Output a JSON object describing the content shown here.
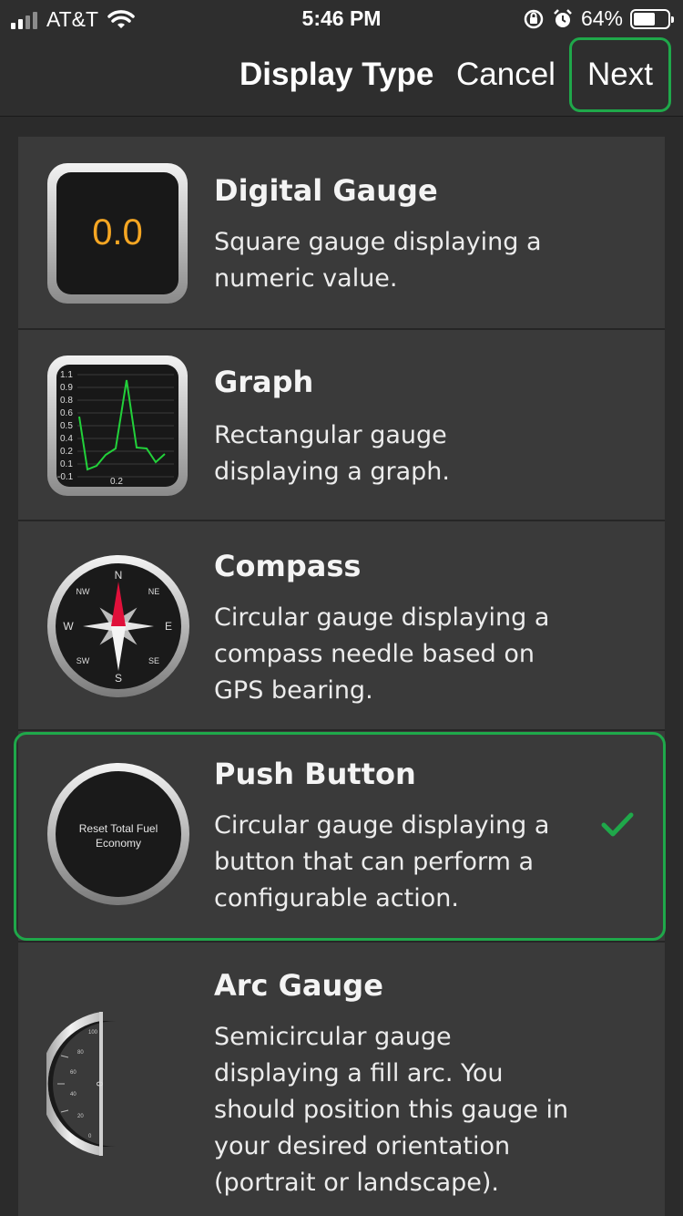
{
  "status_bar": {
    "carrier": "AT&T",
    "time": "5:46 PM",
    "battery_percent": "64%",
    "icons": [
      "signal-icon",
      "wifi-icon",
      "rotation-lock-icon",
      "alarm-icon",
      "battery-icon"
    ]
  },
  "nav": {
    "title": "Display Type",
    "cancel_label": "Cancel",
    "next_label": "Next"
  },
  "items": [
    {
      "title": "Digital Gauge",
      "description": "Square gauge displaying a numeric value.",
      "preview_value": "0.0",
      "icon": "digital-gauge-icon",
      "selected": false
    },
    {
      "title": "Graph",
      "description": "Rectangular gauge displaying a graph.",
      "icon": "graph-gauge-icon",
      "y_ticks": [
        "1.1",
        "0.9",
        "0.8",
        "0.6",
        "0.5",
        "0.4",
        "0.2",
        "0.1",
        "-0.1"
      ],
      "x_label": "0.2",
      "selected": false
    },
    {
      "title": "Compass",
      "description": "Circular gauge displaying a compass needle based on GPS bearing.",
      "icon": "compass-icon",
      "directions": {
        "n": "N",
        "ne": "NE",
        "e": "E",
        "se": "SE",
        "s": "S",
        "sw": "SW",
        "w": "W",
        "nw": "NW"
      },
      "selected": false
    },
    {
      "title": "Push Button",
      "description": "Circular gauge displaying a button that can perform a configurable action.",
      "icon": "push-button-icon",
      "button_line1": "Reset Total Fuel",
      "button_line2": "Economy",
      "selected": true
    },
    {
      "title": "Arc Gauge",
      "description": "Semicircular gauge displaying a fill arc. You should position this gauge in your desired orientation (portrait or landscape).",
      "icon": "arc-gauge-icon",
      "ticks": [
        "100",
        "80",
        "60",
        "40",
        "20",
        "0"
      ],
      "value": "0",
      "selected": false
    }
  ],
  "colors": {
    "accent_green": "#1fa84a",
    "digital_value": "#f5a623",
    "graph_line": "#22d13a",
    "compass_red": "#e0103a"
  }
}
